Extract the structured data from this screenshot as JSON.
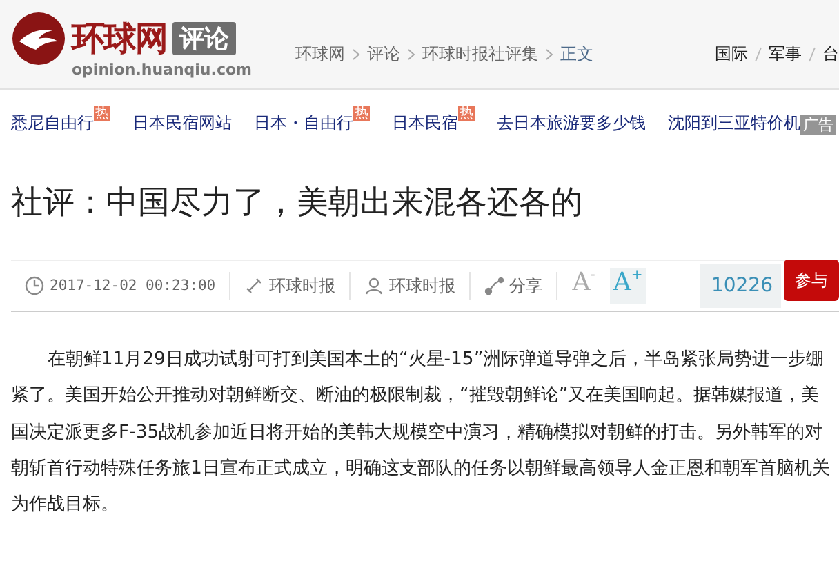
{
  "header": {
    "logo_text": "环球网",
    "section_badge": "评论",
    "domain": "opinion.huanqiu.com",
    "breadcrumbs": [
      "环球网",
      "评论",
      "环球时报社评集",
      "正文"
    ],
    "nav": [
      "国际",
      "军事",
      "台"
    ]
  },
  "ad_links": [
    {
      "label": "悉尼自由行",
      "badge": "热"
    },
    {
      "label": "日本民宿网站"
    },
    {
      "label": "日本・自由行",
      "badge": "热"
    },
    {
      "label": "日本民宿",
      "badge": "热"
    },
    {
      "label": "去日本旅游要多少钱"
    },
    {
      "label": "沈阳到三亚特价机"
    }
  ],
  "ad_label": "广告",
  "article": {
    "title": "社评：中国尽力了，美朝出来混各还各的",
    "meta": {
      "time": "2017-12-02 00:23:00",
      "source": "环球时报",
      "author": "环球时报",
      "share": "分享"
    },
    "font_sizes": [
      {
        "label": "A",
        "sign": "-",
        "selected": false
      },
      {
        "label": "A",
        "sign": "+",
        "selected": true
      }
    ],
    "comment_count": "10226",
    "join_button": "参与",
    "paragraph": "在朝鲜11月29日成功试射可打到美国本土的“火星-15”洲际弹道导弹之后，半岛紧张局势进一步绷紧了。美国开始公开推动对朝鲜断交、断油的极限制裁，“摧毁朝鲜论”又在美国响起。据韩媒报道，美国决定派更多F-35战机参加近日将开始的美韩大规模空中演习，精确模拟对朝鲜的打击。另外韩军的对朝斩首行动特殊任务旅1日宣布正式成立，明确这支部队的任务以朝鲜最高领导人金正恩和朝军首脑机关为作战目标。"
  }
}
